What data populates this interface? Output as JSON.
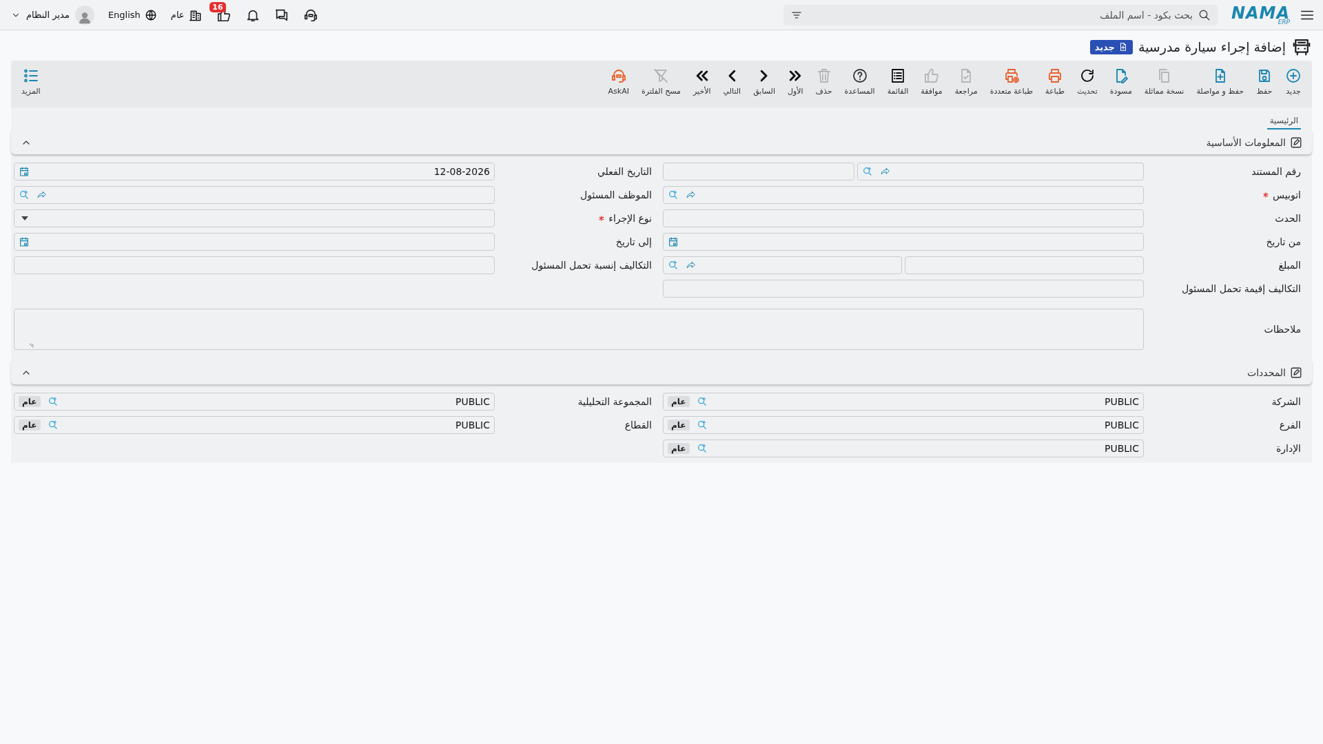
{
  "topbar": {
    "logo": {
      "name": "NAMA",
      "sub": "ERP"
    },
    "search": {
      "placeholder": "بحث بكود - اسم الملف"
    },
    "likes_count": "16",
    "branch": "عام",
    "language": "English",
    "user": "مدير النظام"
  },
  "page": {
    "title": "إضافة إجراء سيارة مدرسية",
    "status": "جديد"
  },
  "toolbar": [
    {
      "label": "جديد",
      "color": "#1a86b0",
      "disabled": false
    },
    {
      "label": "حفظ",
      "color": "#1a86b0",
      "disabled": false
    },
    {
      "label": "حفظ و مواصلة",
      "color": "#1a86b0",
      "disabled": false
    },
    {
      "label": "نسخة مماثلة",
      "disabled": true
    },
    {
      "label": "مسودة",
      "color": "#1a86b0",
      "disabled": false
    },
    {
      "label": "تحديث",
      "color": "#111111",
      "disabled": false
    },
    {
      "label": "طباعة",
      "color": "#e8602c",
      "disabled": false
    },
    {
      "label": "طباعة متعددة",
      "color": "#e8602c",
      "disabled": false
    },
    {
      "label": "مراجعة",
      "disabled": true
    },
    {
      "label": "موافقة",
      "disabled": true
    },
    {
      "label": "القائمة",
      "color": "#111111",
      "disabled": false
    },
    {
      "label": "المساعدة",
      "color": "#333333",
      "disabled": false
    },
    {
      "label": "حذف",
      "disabled": true
    },
    {
      "label": "الأول",
      "color": "#111111",
      "disabled": false
    },
    {
      "label": "السابق",
      "color": "#111111",
      "disabled": false
    },
    {
      "label": "التالي",
      "color": "#111111",
      "disabled": false
    },
    {
      "label": "الأخير",
      "color": "#111111",
      "disabled": false
    },
    {
      "label": "مسح الفلترة",
      "disabled": true
    },
    {
      "label": "AskAI",
      "color": "#e8602c",
      "disabled": false
    }
  ],
  "more": "المزيد",
  "tabs": [
    {
      "label": "الرئيسية",
      "selected": true
    }
  ],
  "sections": [
    {
      "title": "المعلومات الأساسية",
      "expanded": true,
      "fields": [
        {
          "label": "رقم المستند",
          "kind": "lookup-split",
          "required": false
        },
        {
          "label": "التاريخ الفعلي",
          "kind": "date",
          "required": false,
          "value": "12-08-2026"
        },
        {
          "label": "اتوبيس",
          "kind": "lookup",
          "required": true
        },
        {
          "label": "الموظف المسئول",
          "kind": "lookup",
          "required": false
        },
        {
          "label": "الحدث",
          "kind": "text",
          "required": false
        },
        {
          "label": "نوع الإجراء",
          "kind": "select",
          "required": true
        },
        {
          "label": "من تاريخ",
          "kind": "date",
          "required": false
        },
        {
          "label": "إلى تاريخ",
          "kind": "date",
          "required": false
        },
        {
          "label": "المبلغ",
          "kind": "split-lookup",
          "required": false
        },
        {
          "label": "التكاليف إنسبة تحمل المسئول",
          "kind": "text",
          "required": false
        },
        {
          "label": "التكاليف إقيمة تحمل المسئول",
          "kind": "text",
          "required": false
        },
        {
          "label": "ملاحظات",
          "kind": "notes",
          "required": false
        }
      ]
    },
    {
      "title": "المحددات",
      "expanded": true,
      "fields": [
        {
          "label": "الشركة",
          "kind": "org",
          "required": false,
          "value": "PUBLIC",
          "tag": "عام"
        },
        {
          "label": "المجموعة التحليلية",
          "kind": "org",
          "required": false,
          "value": "PUBLIC",
          "tag": "عام"
        },
        {
          "label": "الفرع",
          "kind": "org",
          "required": false,
          "value": "PUBLIC",
          "tag": "عام"
        },
        {
          "label": "القطاع",
          "kind": "org",
          "required": false,
          "value": "PUBLIC",
          "tag": "عام"
        },
        {
          "label": "الإدارة",
          "kind": "org",
          "required": false,
          "value": "PUBLIC",
          "tag": "عام"
        }
      ]
    }
  ]
}
